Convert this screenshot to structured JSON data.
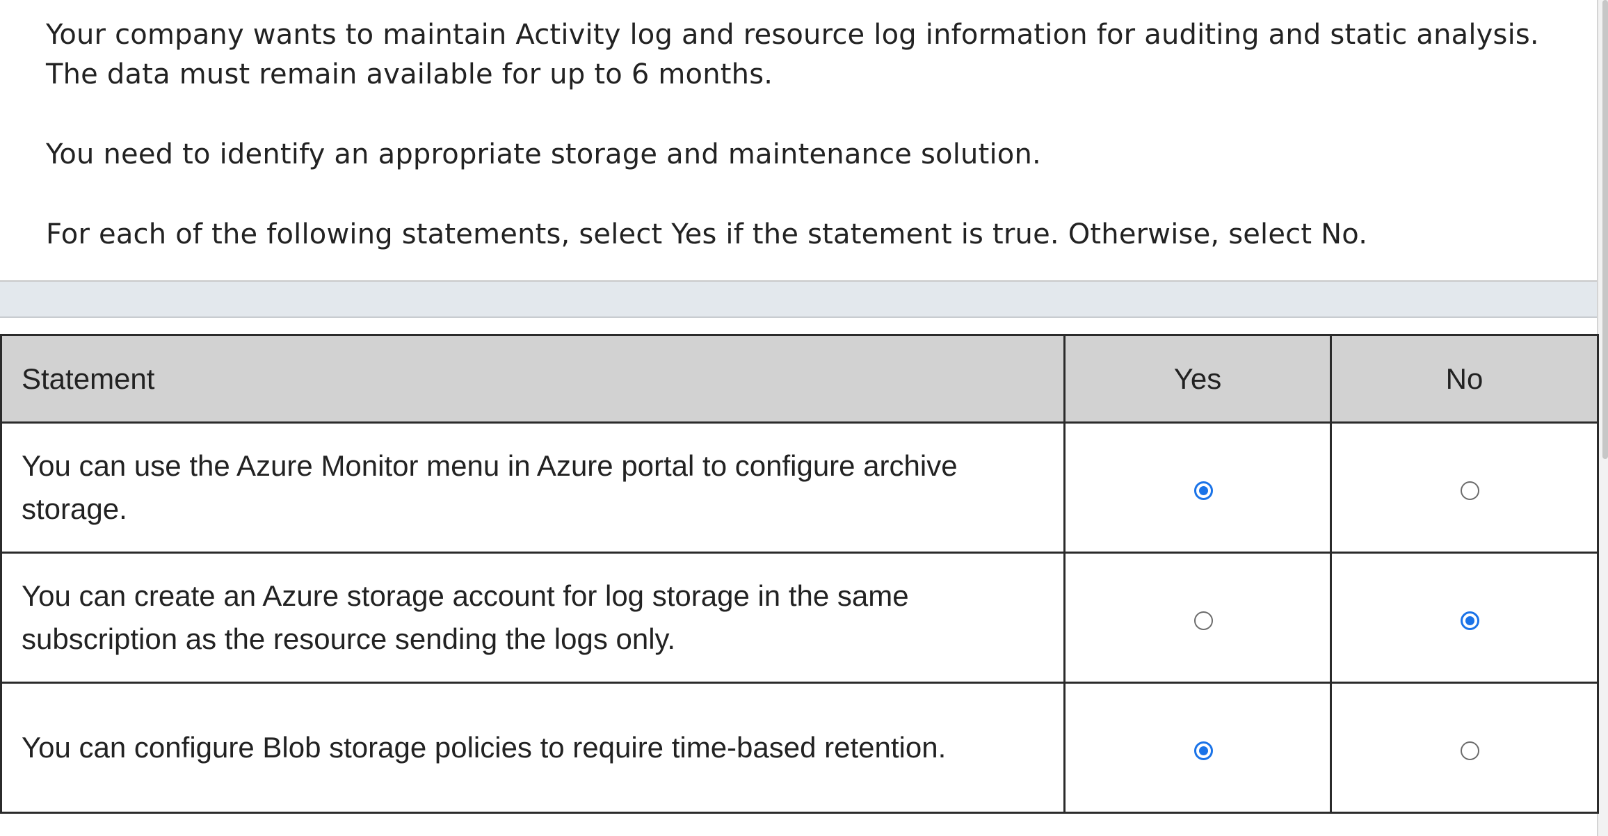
{
  "prompt": {
    "line1": "Your company wants to maintain Activity log and resource log information for auditing and static analysis.",
    "line2": "The data must remain available for up to 6 months.",
    "line3": "You need to identify an appropriate storage and maintenance solution.",
    "line4": "For each of the following statements, select Yes if the statement is true. Otherwise, select No."
  },
  "table": {
    "headers": {
      "statement": "Statement",
      "yes": "Yes",
      "no": "No"
    },
    "rows": [
      {
        "text": "You can use the Azure Monitor menu in Azure portal to configure archive storage.",
        "selected": "yes"
      },
      {
        "text": "You can create an Azure storage account for log storage in the same subscription as the resource sending the logs only.",
        "selected": "no"
      },
      {
        "text": "You can configure Blob storage policies to require time-based retention.",
        "selected": "yes"
      }
    ]
  },
  "colors": {
    "radio_selected": "#1a73e8",
    "header_bg": "#d2d2d2",
    "band_bg": "#e3e8ed"
  }
}
